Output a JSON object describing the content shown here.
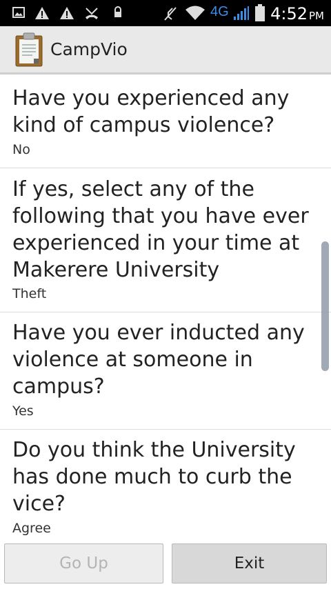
{
  "status_bar": {
    "time": "4:52",
    "ampm": "PM",
    "network": "4G"
  },
  "app": {
    "title": "CampVio",
    "icon": "clipboard-icon"
  },
  "items": [
    {
      "question": "Have you experienced any kind of campus violence?",
      "answer": "No"
    },
    {
      "question": "If yes, select any of the following that you have ever experienced in your time at Makerere University",
      "answer": "Theft"
    },
    {
      "question": "Have you ever inducted any violence at someone in campus?",
      "answer": "Yes"
    },
    {
      "question": "Do you think the University has done much to curb the vice?",
      "answer": "Agree"
    }
  ],
  "buttons": {
    "go_up": "Go Up",
    "exit": "Exit"
  },
  "colors": {
    "status_bar": "#000000",
    "action_bar": "#e9e9e9",
    "network_accent": "#3a8ee6"
  }
}
